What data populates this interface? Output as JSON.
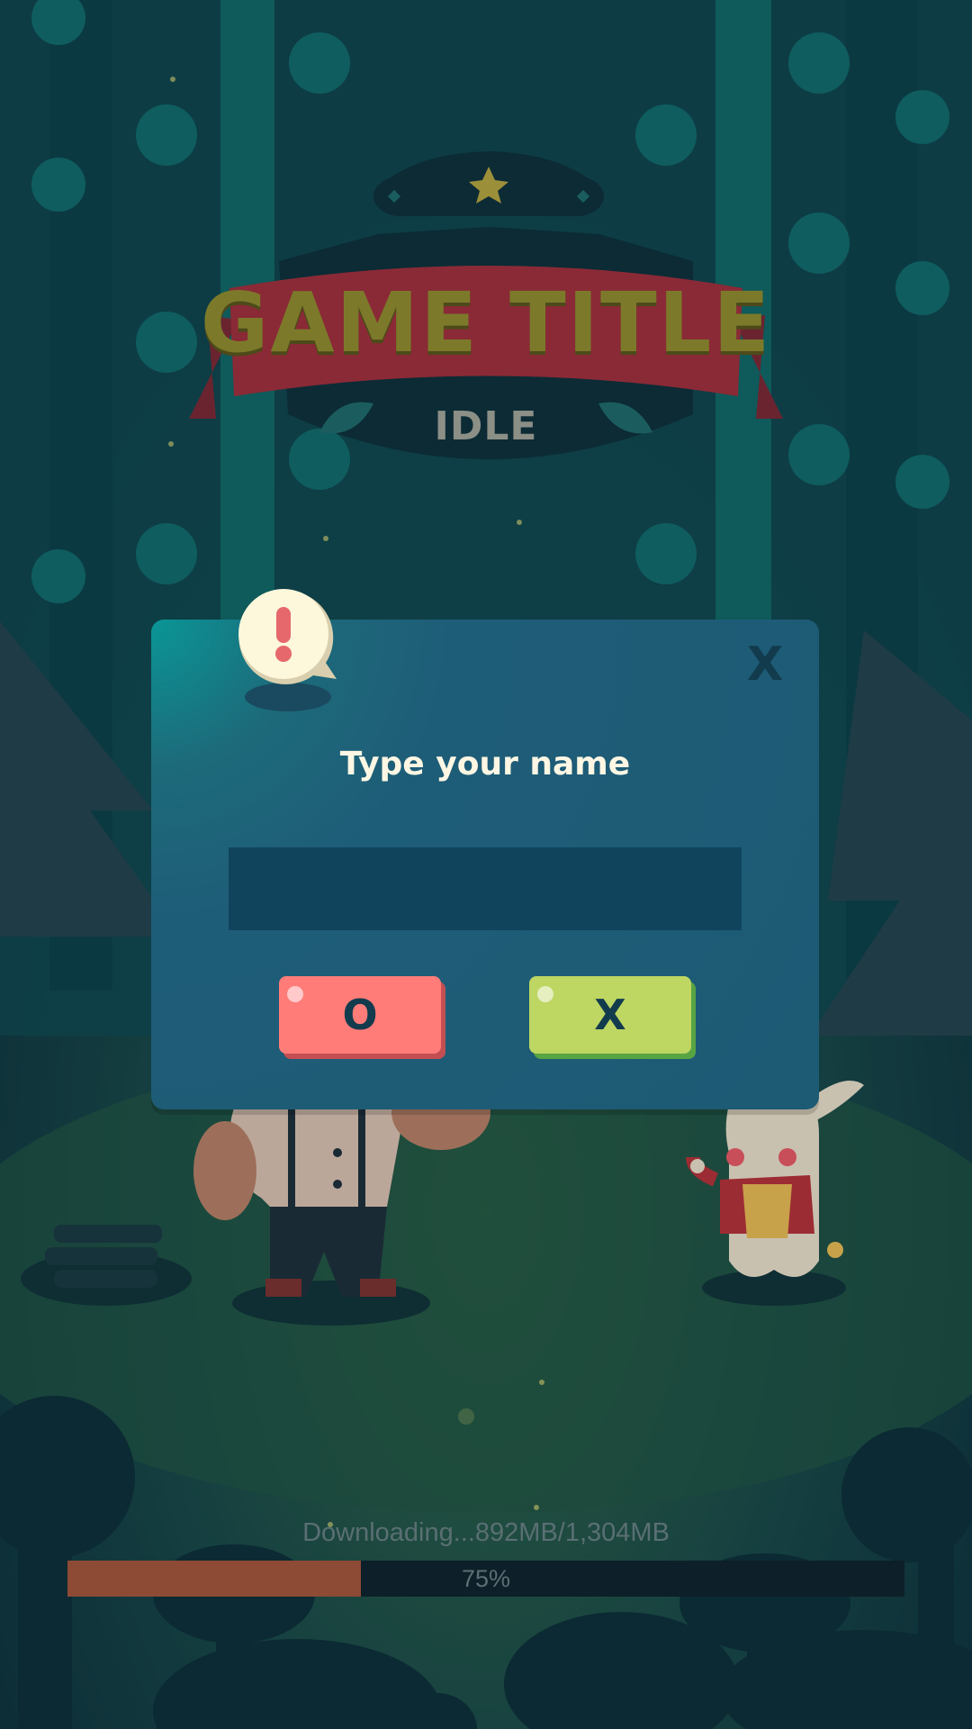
{
  "title": {
    "main": "GAME TITLE",
    "sub": "IDLE"
  },
  "dialog": {
    "title": "Type your name",
    "close_label": "X",
    "input_value": "",
    "input_placeholder": "",
    "ok_label": "O",
    "cancel_label": "X",
    "alert_icon": "exclamation-speech-bubble-icon"
  },
  "loading": {
    "text": "Downloading...892MB/1,304MB",
    "percent_label": "75%",
    "progress_fraction": 0.35
  },
  "colors": {
    "ok_button": "#ff7c79",
    "cancel_button": "#bed662",
    "dialog_bg": "#1d5a74",
    "progress_fill": "#8d4a35",
    "banner_red": "#8a2a36"
  }
}
